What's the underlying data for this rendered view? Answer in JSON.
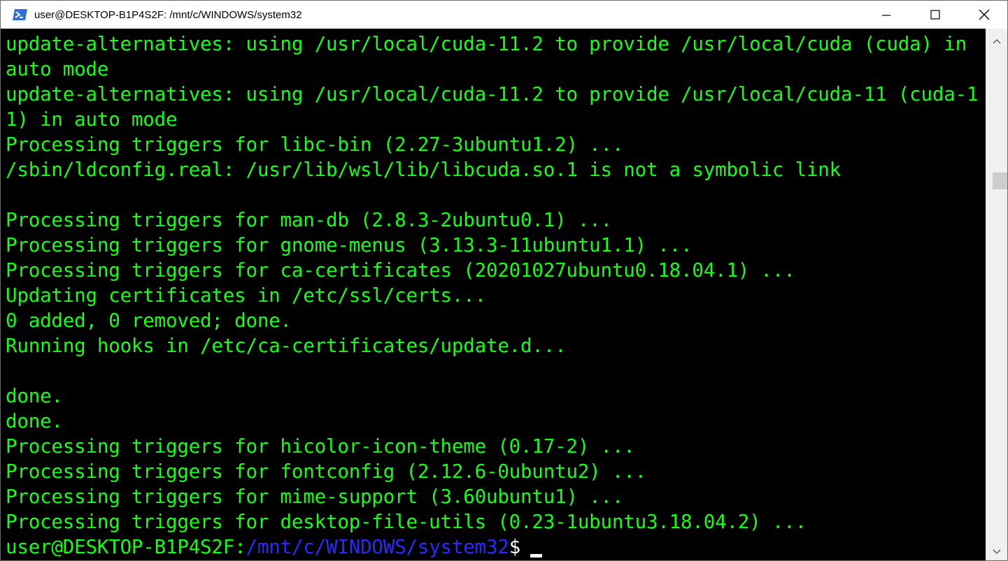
{
  "window": {
    "title": "user@DESKTOP-B1P4S2F: /mnt/c/WINDOWS/system32",
    "icon": "powershell-icon",
    "buttons": [
      "minimize-icon",
      "maximize-icon",
      "close-icon"
    ]
  },
  "terminal": {
    "colors": {
      "text": "#13ff13",
      "path": "#2a2aff",
      "background": "#000000"
    },
    "lines": [
      "update-alternatives: using /usr/local/cuda-11.2 to provide /usr/local/cuda (cuda) in",
      "auto mode",
      "update-alternatives: using /usr/local/cuda-11.2 to provide /usr/local/cuda-11 (cuda-1",
      "1) in auto mode",
      "Processing triggers for libc-bin (2.27-3ubuntu1.2) ...",
      "/sbin/ldconfig.real: /usr/lib/wsl/lib/libcuda.so.1 is not a symbolic link",
      "",
      "Processing triggers for man-db (2.8.3-2ubuntu0.1) ...",
      "Processing triggers for gnome-menus (3.13.3-11ubuntu1.1) ...",
      "Processing triggers for ca-certificates (20201027ubuntu0.18.04.1) ...",
      "Updating certificates in /etc/ssl/certs...",
      "0 added, 0 removed; done.",
      "Running hooks in /etc/ca-certificates/update.d...",
      "",
      "done.",
      "done.",
      "Processing triggers for hicolor-icon-theme (0.17-2) ...",
      "Processing triggers for fontconfig (2.12.6-0ubuntu2) ...",
      "Processing triggers for mime-support (3.60ubuntu1) ...",
      "Processing triggers for desktop-file-utils (0.23-1ubuntu3.18.04.2) ..."
    ],
    "prompt": {
      "user_host": "user@DESKTOP-B1P4S2F",
      "separator": ":",
      "path": "/mnt/c/WINDOWS/system32",
      "symbol": "$"
    }
  },
  "scrollbar": {
    "up_icon": "scroll-up-arrow-icon",
    "down_icon": "scroll-down-arrow-icon"
  }
}
